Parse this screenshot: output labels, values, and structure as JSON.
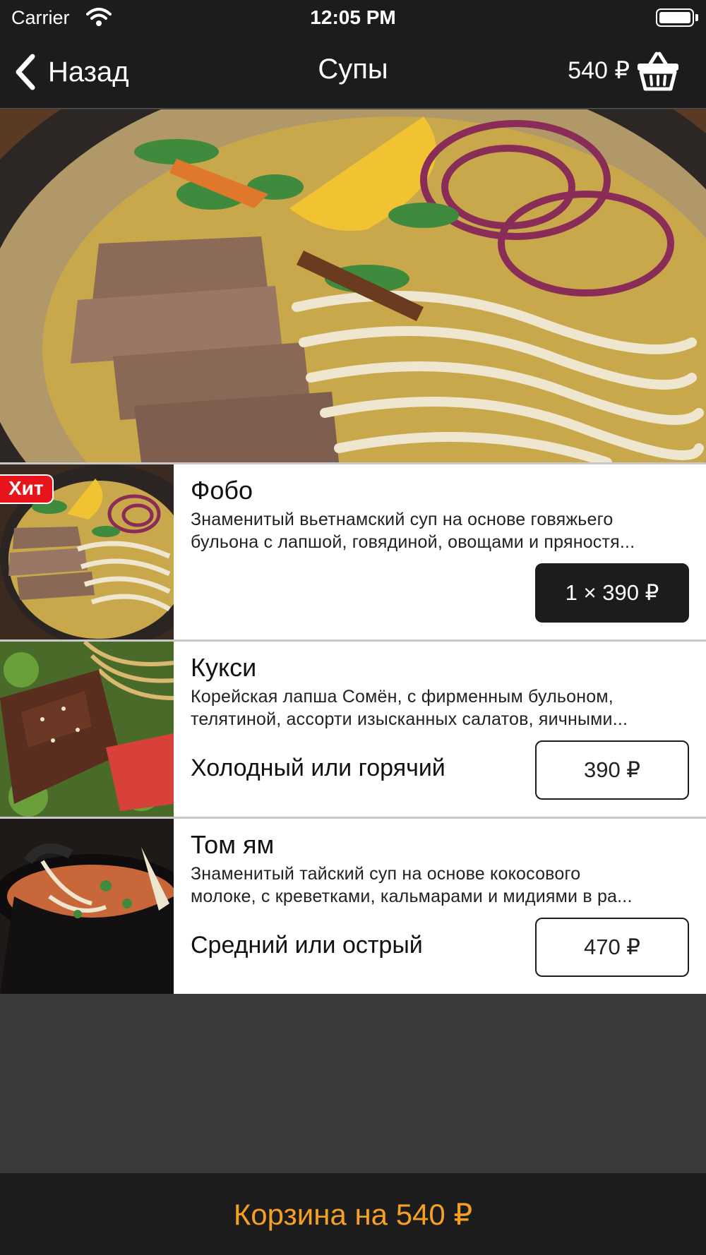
{
  "status_bar": {
    "carrier": "Carrier",
    "time": "12:05 PM"
  },
  "nav": {
    "back_label": "Назад",
    "title": "Супы",
    "cart_total": "540 ₽",
    "cart_icon": "basket-icon"
  },
  "products": [
    {
      "name": "Фобо",
      "badge": "Хит",
      "desc_line1": "Знаменитый вьетнамский суп на основе говяжьего",
      "desc_line2": "бульона с лапшой, говядиной, овощами и пряностя...",
      "option": "",
      "price_label": "1 × 390 ₽",
      "in_cart": true
    },
    {
      "name": "Кукси",
      "badge": "",
      "desc_line1": "Корейская лапша Сомён, с фирменным бульоном,",
      "desc_line2": "телятиной, ассорти изысканных салатов, яичными...",
      "option": "Холодный или горячий",
      "price_label": "390 ₽",
      "in_cart": false
    },
    {
      "name": "Том ям",
      "badge": "",
      "desc_line1": "Знаменитый тайский суп на основе кокосового",
      "desc_line2": "молоке, с креветками, кальмарами и мидиями в ра...",
      "option": "Средний или острый",
      "price_label": "470 ₽",
      "in_cart": false
    }
  ],
  "bottom": {
    "cart_button_label": "Корзина на 540 ₽"
  },
  "colors": {
    "bar_bg": "#1c1c1c",
    "accent": "#f5a023",
    "badge": "#e8141b",
    "list_bg": "#ffffff",
    "page_bg": "#3a3a3a"
  }
}
